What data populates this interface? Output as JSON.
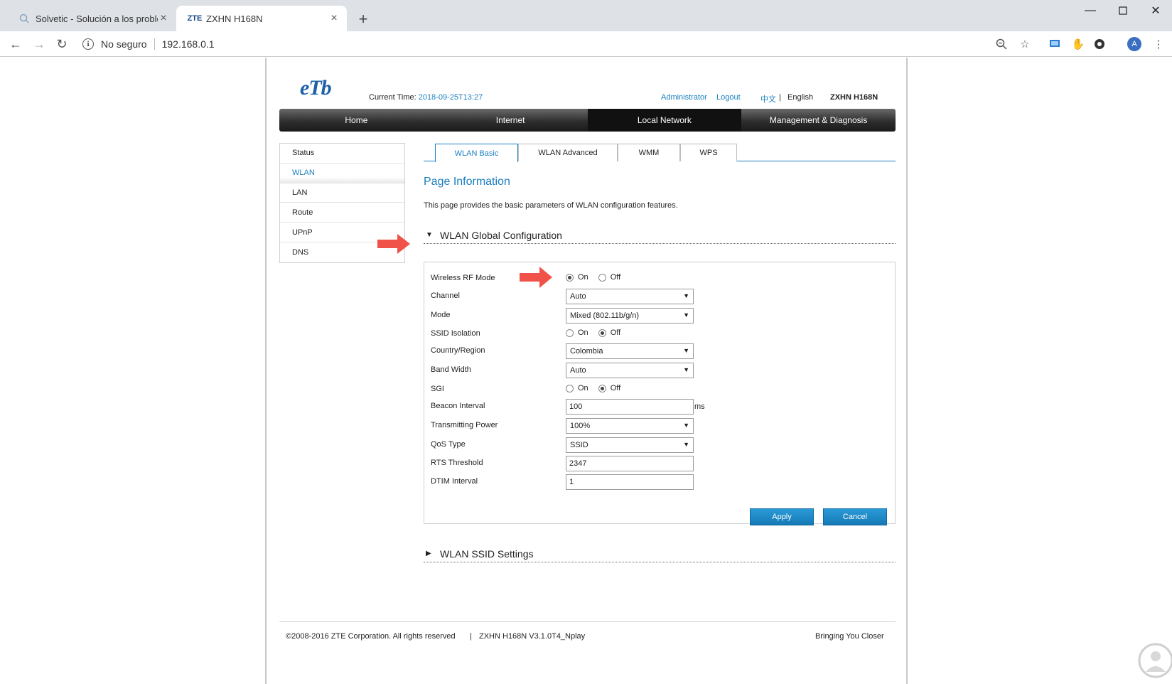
{
  "browser": {
    "tabs": [
      {
        "title": "Solvetic - Solución a los problem",
        "active": false
      },
      {
        "title": "ZXHN H168N",
        "favicon_text": "ZTE",
        "active": true
      }
    ],
    "security_text": "No seguro",
    "url": "192.168.0.1",
    "avatar_letter": "A"
  },
  "header": {
    "logo": "eTb",
    "current_time_label": "Current Time:",
    "current_time_value": "2018-09-25T13:27",
    "admin": "Administrator",
    "logout": "Logout",
    "lang_cn": "中文",
    "lang_sep": "|",
    "lang_en": "English",
    "model": "ZXHN H168N"
  },
  "nav": [
    "Home",
    "Internet",
    "Local Network",
    "Management & Diagnosis"
  ],
  "nav_selected": "Local Network",
  "sidebar": [
    "Status",
    "WLAN",
    "LAN",
    "Route",
    "UPnP",
    "DNS"
  ],
  "sidebar_selected": "WLAN",
  "tabs": [
    "WLAN Basic",
    "WLAN Advanced",
    "WMM",
    "WPS"
  ],
  "tab_selected": "WLAN Basic",
  "page_info": {
    "title": "Page Information",
    "description": "This page provides the basic parameters of WLAN configuration features."
  },
  "sections": {
    "global": "WLAN Global Configuration",
    "ssid": "WLAN SSID Settings"
  },
  "form": {
    "wireless_rf_mode": {
      "label": "Wireless RF Mode",
      "on": "On",
      "off": "Off",
      "value": "On"
    },
    "channel": {
      "label": "Channel",
      "value": "Auto"
    },
    "mode": {
      "label": "Mode",
      "value": "Mixed (802.11b/g/n)"
    },
    "ssid_isolation": {
      "label": "SSID Isolation",
      "on": "On",
      "off": "Off",
      "value": "Off"
    },
    "country": {
      "label": "Country/Region",
      "value": "Colombia"
    },
    "bandwidth": {
      "label": "Band Width",
      "value": "Auto"
    },
    "sgi": {
      "label": "SGI",
      "on": "On",
      "off": "Off",
      "value": "Off"
    },
    "beacon": {
      "label": "Beacon Interval",
      "value": "100",
      "unit": "ms"
    },
    "tx_power": {
      "label": "Transmitting Power",
      "value": "100%"
    },
    "qos": {
      "label": "QoS Type",
      "value": "SSID"
    },
    "rts": {
      "label": "RTS Threshold",
      "value": "2347"
    },
    "dtim": {
      "label": "DTIM Interval",
      "value": "1"
    }
  },
  "buttons": {
    "apply": "Apply",
    "cancel": "Cancel"
  },
  "footer": {
    "copyright": "©2008-2016 ZTE Corporation. All rights reserved",
    "sep": "|",
    "version": "ZXHN H168N V3.1.0T4_Nplay",
    "slogan": "Bringing You Closer"
  },
  "colors": {
    "accent": "#1a7fc1",
    "arrow": "#f0524a",
    "nav_dark": "#1a1a1a"
  }
}
